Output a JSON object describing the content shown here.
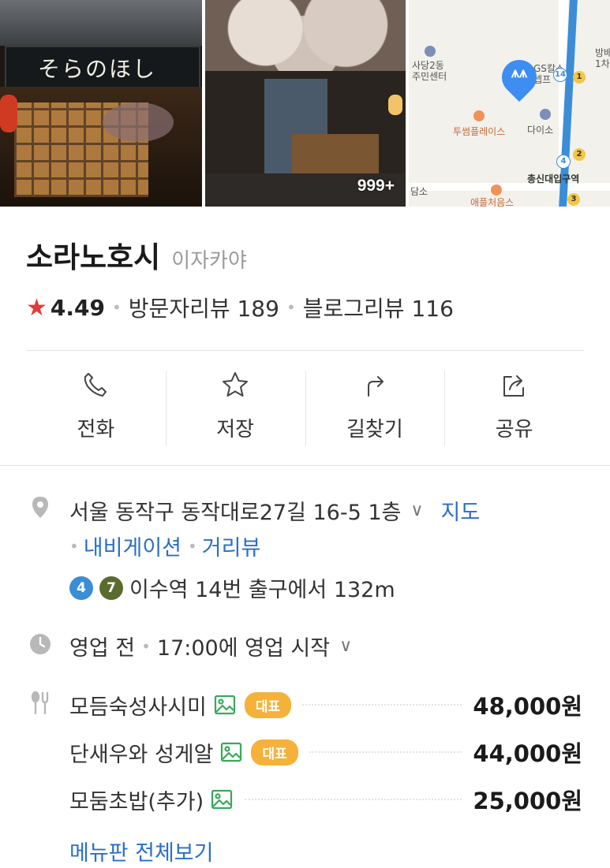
{
  "photos": {
    "first_sign_text": "そらのほし",
    "photo_count": "999+",
    "map_labels": {
      "community_center": "사당2동\n주민센터",
      "gs": "GS칼스\n셉프",
      "store_right": "방배\n1차",
      "tuscum": "투썸플레이스",
      "daiso": "다이소",
      "station": "총신대입구역",
      "danso": "담소",
      "bottom": "애플처음스"
    },
    "map_station_numbers": [
      "14",
      "1",
      "2",
      "4",
      "3"
    ]
  },
  "place": {
    "name": "소라노호시",
    "category": "이자카야",
    "rating": "4.49",
    "visitor_reviews": "방문자리뷰 189",
    "blog_reviews": "블로그리뷰 116"
  },
  "actions": [
    {
      "label": "전화",
      "icon": "phone-icon"
    },
    {
      "label": "저장",
      "icon": "star-icon"
    },
    {
      "label": "길찾기",
      "icon": "directions-icon"
    },
    {
      "label": "공유",
      "icon": "share-icon"
    }
  ],
  "info": {
    "address": "서울 동작구 동작대로27길 16-5 1층",
    "map_link": "지도",
    "navigation_link": "내비게이션",
    "streetview_link": "거리뷰",
    "subway_lines": [
      "4",
      "7"
    ],
    "subway_text": "이수역 14번 출구에서 132m",
    "hours_state": "영업 전",
    "hours_text": "17:00에 영업 시작"
  },
  "menu": {
    "items": [
      {
        "name": "모듬숙성사시미",
        "badge": "대표",
        "price": "48,000원"
      },
      {
        "name": "단새우와 성게알",
        "badge": "대표",
        "price": "44,000원"
      },
      {
        "name": "모둠초밥(추가)",
        "badge": "",
        "price": "25,000원"
      }
    ],
    "view_all": "메뉴판 전체보기"
  },
  "colors": {
    "accent_link": "#2a6fc9",
    "star": "#e23b3b",
    "badge": "#f4b23a",
    "line4": "#3b8dd6",
    "line7": "#5a6b2f"
  }
}
